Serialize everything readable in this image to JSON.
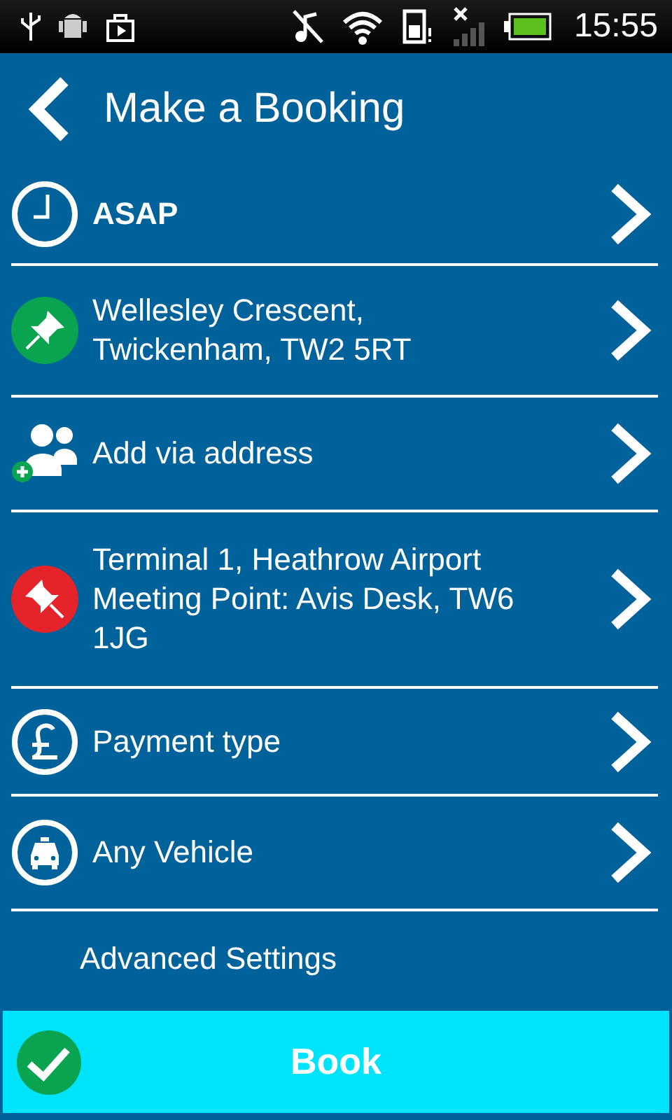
{
  "status_bar": {
    "time": "15:55"
  },
  "header": {
    "title": "Make a Booking"
  },
  "rows": [
    {
      "kind": "time",
      "lines": [
        "ASAP"
      ]
    },
    {
      "kind": "pickup",
      "color": "#0aa34f",
      "lines": [
        "Wellesley Crescent,",
        "Twickenham, TW2 5RT"
      ]
    },
    {
      "kind": "via",
      "lines": [
        "Add via address"
      ]
    },
    {
      "kind": "dropoff",
      "color": "#e5232b",
      "lines": [
        "Terminal 1, Heathrow Airport",
        "Meeting Point: Avis Desk, TW6",
        "1JG"
      ]
    },
    {
      "kind": "payment",
      "lines": [
        "Payment type"
      ]
    },
    {
      "kind": "vehicle",
      "lines": [
        "Any Vehicle"
      ]
    }
  ],
  "advanced": {
    "title": "Advanced Settings"
  },
  "book_button": {
    "label": "Book"
  }
}
